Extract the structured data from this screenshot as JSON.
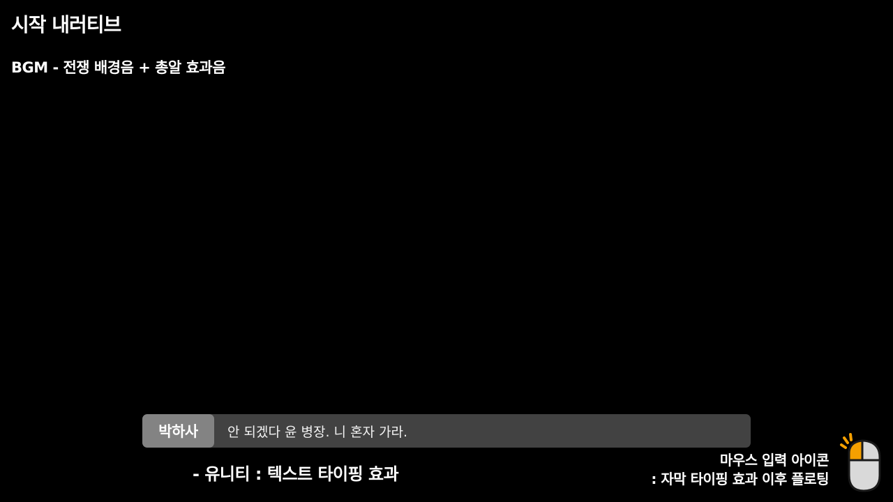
{
  "title": "시작 내러티브",
  "bgm_note": "BGM - 전쟁 배경음 + 총알 효과음",
  "dialogue": {
    "speaker": "박하사",
    "text": "안 되겠다 윤 병장. 니 혼자 가라."
  },
  "unity_note": "- 유니티 : 텍스트 타이핑 효과",
  "mouse_note": {
    "line1": "마우스 입력 아이콘",
    "line2": ": 자막 타이핑 효과 이후 플로팅"
  },
  "mouse_icon": {
    "name": "mouse-click-icon",
    "button_color": "#f5a000",
    "body_color": "#d9d9d9"
  }
}
